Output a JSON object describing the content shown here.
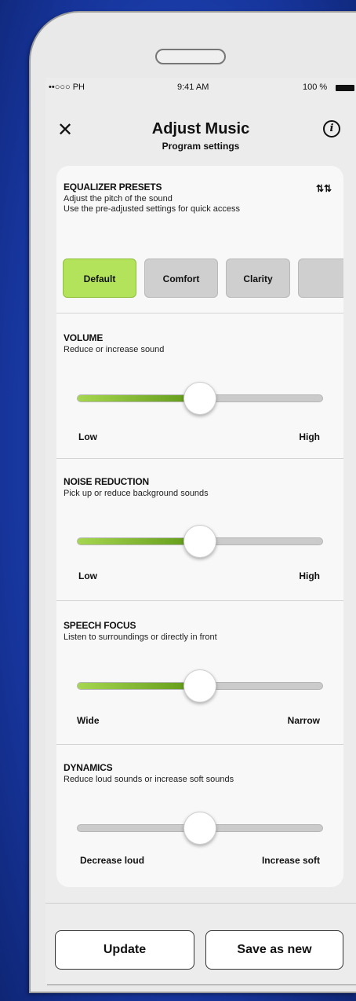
{
  "status_bar": {
    "carrier": "••○○○ PH",
    "time": "9:41 AM",
    "battery": "100 %"
  },
  "header": {
    "title": "Adjust Music",
    "subtitle": "Program settings"
  },
  "equalizer": {
    "title": "EQUALIZER PRESETS",
    "desc1": "Adjust the pitch of the sound",
    "desc2": "Use the pre-adjusted settings for quick access",
    "presets": [
      {
        "label": "Default",
        "active": true
      },
      {
        "label": "Comfort",
        "active": false
      },
      {
        "label": "Clarity",
        "active": false
      },
      {
        "label": "",
        "active": false
      }
    ]
  },
  "sliders": [
    {
      "title": "VOLUME",
      "desc": "Reduce or increase sound",
      "low": "Low",
      "high": "High",
      "value": 0.5
    },
    {
      "title": "NOISE REDUCTION",
      "desc": "Pick up or reduce background sounds",
      "low": "Low",
      "high": "High",
      "value": 0.5
    },
    {
      "title": "SPEECH FOCUS",
      "desc": "Listen to surroundings or directly in front",
      "low": "Wide",
      "high": "Narrow",
      "value": 0.5
    },
    {
      "title": "DYNAMICS",
      "desc": "Reduce loud sounds or increase soft sounds",
      "low": "Decrease loud",
      "high": "Increase soft",
      "value": 0.5
    }
  ],
  "footer": {
    "update_label": "Update",
    "save_label": "Save as new"
  },
  "colors": {
    "accent": "#b3e35a",
    "fill_dark": "#5e9716",
    "background": "#1f43b6"
  }
}
